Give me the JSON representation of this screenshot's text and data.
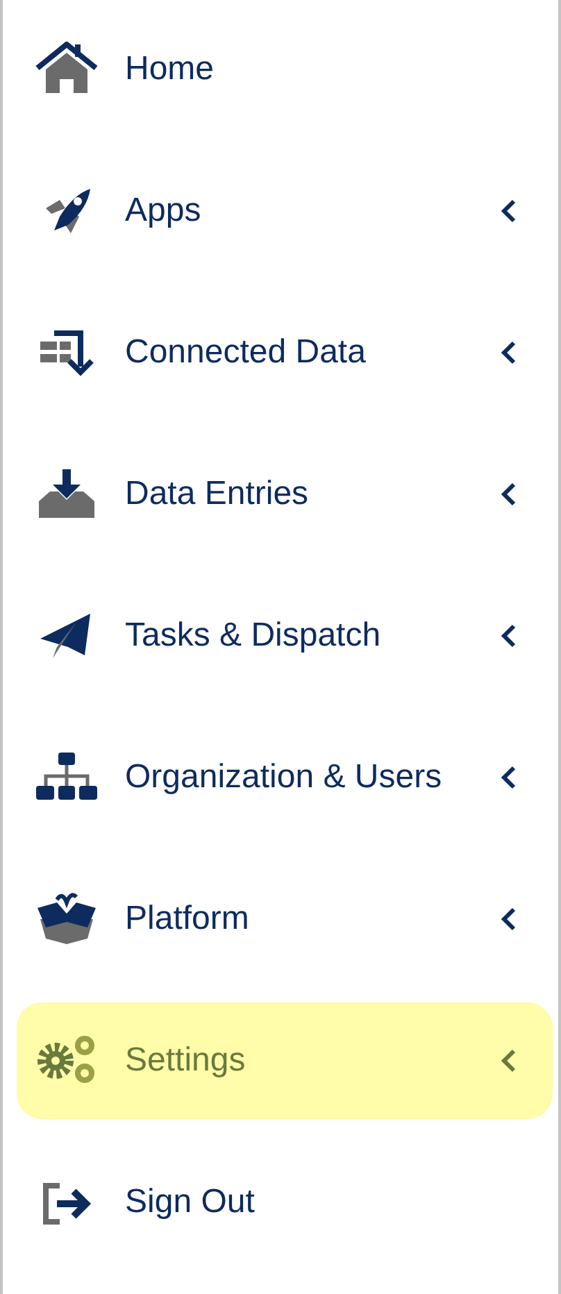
{
  "menu": {
    "items": [
      {
        "label": "Home",
        "expandable": false,
        "selected": false
      },
      {
        "label": "Apps",
        "expandable": true,
        "selected": false
      },
      {
        "label": "Connected Data",
        "expandable": true,
        "selected": false
      },
      {
        "label": "Data Entries",
        "expandable": true,
        "selected": false
      },
      {
        "label": "Tasks & Dispatch",
        "expandable": true,
        "selected": false
      },
      {
        "label": "Organization & Users",
        "expandable": true,
        "selected": false
      },
      {
        "label": "Platform",
        "expandable": true,
        "selected": false
      },
      {
        "label": "Settings",
        "expandable": true,
        "selected": true
      },
      {
        "label": "Sign Out",
        "expandable": false,
        "selected": false
      }
    ]
  }
}
